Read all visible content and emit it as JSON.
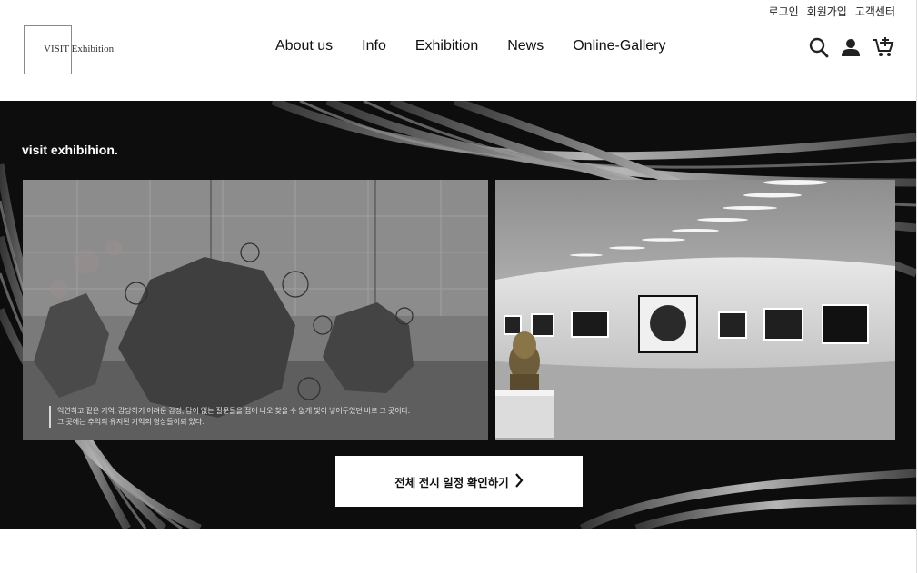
{
  "header": {
    "util_links": [
      "로그인",
      "회원가입",
      "고객센터"
    ],
    "logo_text": "VISIT Exhibition",
    "nav": [
      "About us",
      "Info",
      "Exhibition",
      "News",
      "Online-Gallery"
    ],
    "icons": [
      "search-icon",
      "user-icon",
      "cart-icon"
    ]
  },
  "hero": {
    "caption": "visit exhibihion.",
    "quote_lines": [
      "익연하고 짙은 기억, 감당하기 어려운 감정, 답이 없는 질문들을 접어 나오 찾을 수 없게 빛이 넣어두었던 바로 그 곳이다.",
      "그 곳에는 추억의 유지된 기억의 형상들이뢰 있다."
    ],
    "cta_label": "전체 전시 일정 확인하기"
  }
}
